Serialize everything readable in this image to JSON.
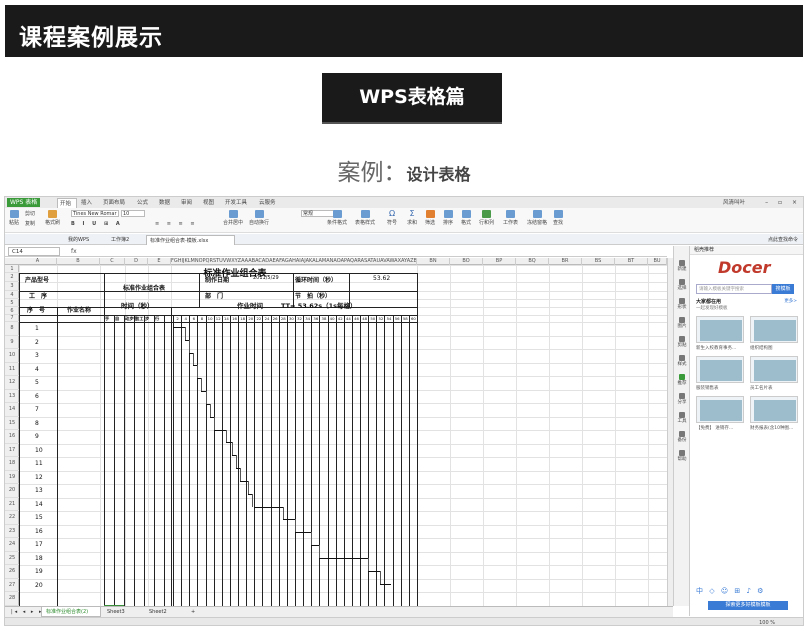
{
  "banner": {
    "title": "课程案例展示"
  },
  "badge": {
    "label": "WPS表格篇"
  },
  "caption": {
    "prefix": "案例：",
    "text": "设计表格"
  },
  "app": {
    "logo": "WPS 表格",
    "menu_tabs": [
      "开始",
      "插入",
      "页面布局",
      "公式",
      "数据",
      "审阅",
      "视图",
      "开发工具",
      "云服务"
    ],
    "selected_menu": "开始",
    "title_right": "风清叫叶",
    "ribbon": {
      "paste": "粘贴",
      "cut": "剪切",
      "copy": "复制",
      "format_painter": "格式刷",
      "font": "Tines New Romar",
      "size": "10",
      "merge": "合并居中",
      "wrap": "自动换行",
      "number_format": "常规",
      "cond_format": "条件格式",
      "table_style": "表格样式",
      "symbol": "符号",
      "sum": "求和",
      "filter": "筛选",
      "sort": "排序",
      "format": "格式",
      "rowcol": "行和列",
      "sheet": "工作表",
      "freeze": "冻结窗格",
      "find": "查找"
    },
    "doc_tabs": [
      "我的WPS",
      "工作簿2",
      "标准作业组合表-模板.xlsx"
    ],
    "selected_doc": "标准作业组合表-模板.xlsx",
    "right_link": "点此查找命令",
    "namebox": "C14",
    "fx": "fx",
    "columns": [
      "A",
      "B",
      "C",
      "D",
      "E",
      "FGHIJKLMNOPQRSTUVWXYZAAABACADAEAFAGAHAIAJAKALAMANAOAPAQARASATAUAVAWAXAYAZBABBBCBDBEBFBGBHBIBJBKBLBMBNBOBPBQBRBSBTBU",
      "BN",
      "BO",
      "BP",
      "BQ",
      "BR",
      "BS",
      "BT",
      "BU"
    ],
    "rows": [
      "1",
      "2",
      "3",
      "4",
      "5",
      "6",
      "7",
      "8",
      "9",
      "10",
      "11",
      "12",
      "13",
      "14",
      "15",
      "16",
      "17",
      "18",
      "19",
      "20",
      "21",
      "22",
      "23",
      "24",
      "25",
      "26",
      "27",
      "28",
      "29",
      "30",
      "31"
    ],
    "sheet": {
      "title": "标准作业组合表",
      "product_label": "产品型号",
      "process_label": "工　序",
      "center_label": "标准作业组合表",
      "date_label": "制作日期",
      "date_value": "2011/5/29",
      "cycle_label": "循环时间（秒）",
      "cycle_value": "53.62",
      "dept_label": "部　门",
      "takt_label": "节　拍（秒）",
      "time_header": "时间（秒）",
      "seq_label": "序　号",
      "name_label": "作业名称",
      "time_cols": [
        "手",
        "自",
        "动步行",
        "加工",
        "步",
        "行"
      ],
      "work_time_label": "作业时间",
      "tt_label": "TT= 53.62s（1s每格）",
      "ticks": [
        "2",
        "4",
        "6",
        "8",
        "10",
        "12",
        "14",
        "16",
        "18",
        "20",
        "22",
        "24",
        "26",
        "28",
        "30",
        "32",
        "34",
        "36",
        "38",
        "40",
        "42",
        "44",
        "46",
        "48",
        "50",
        "52",
        "54",
        "56",
        "58",
        "60"
      ],
      "seq": [
        "1",
        "2",
        "3",
        "4",
        "5",
        "6",
        "7",
        "8",
        "9",
        "10",
        "11",
        "12",
        "13",
        "14",
        "15",
        "16",
        "17",
        "18",
        "19",
        "20"
      ]
    },
    "sidebar": [
      "新建",
      "选择",
      "形状",
      "图片",
      "剪贴",
      "样式",
      "推荐",
      "分享",
      "工具",
      "备份",
      "帮助"
    ],
    "template_panel": {
      "header": "稻壳推荐",
      "logo": "Docer",
      "search_placeholder": "请输入模板关键字搜索",
      "search_btn": "搜模板",
      "section": "大家都在用",
      "section_sub": "一起发现好模板",
      "more": "更多>",
      "items": [
        "新生入校教育事务...",
        "组织结构图",
        "服装销售表",
        "员工名片表",
        "【免费】 进销存...",
        "财务报表(含10种图..."
      ],
      "bottom_icons": "中 ◇ ☺ ⊞ ♪ ⚙",
      "bottom_btn": "探索更多好模板模板"
    },
    "sheet_tabs": [
      "标准作业组合表(2)",
      "Sheet3",
      "Sheet2"
    ],
    "selected_sheet": "标准作业组合表(2)",
    "zoom": "100 %"
  }
}
